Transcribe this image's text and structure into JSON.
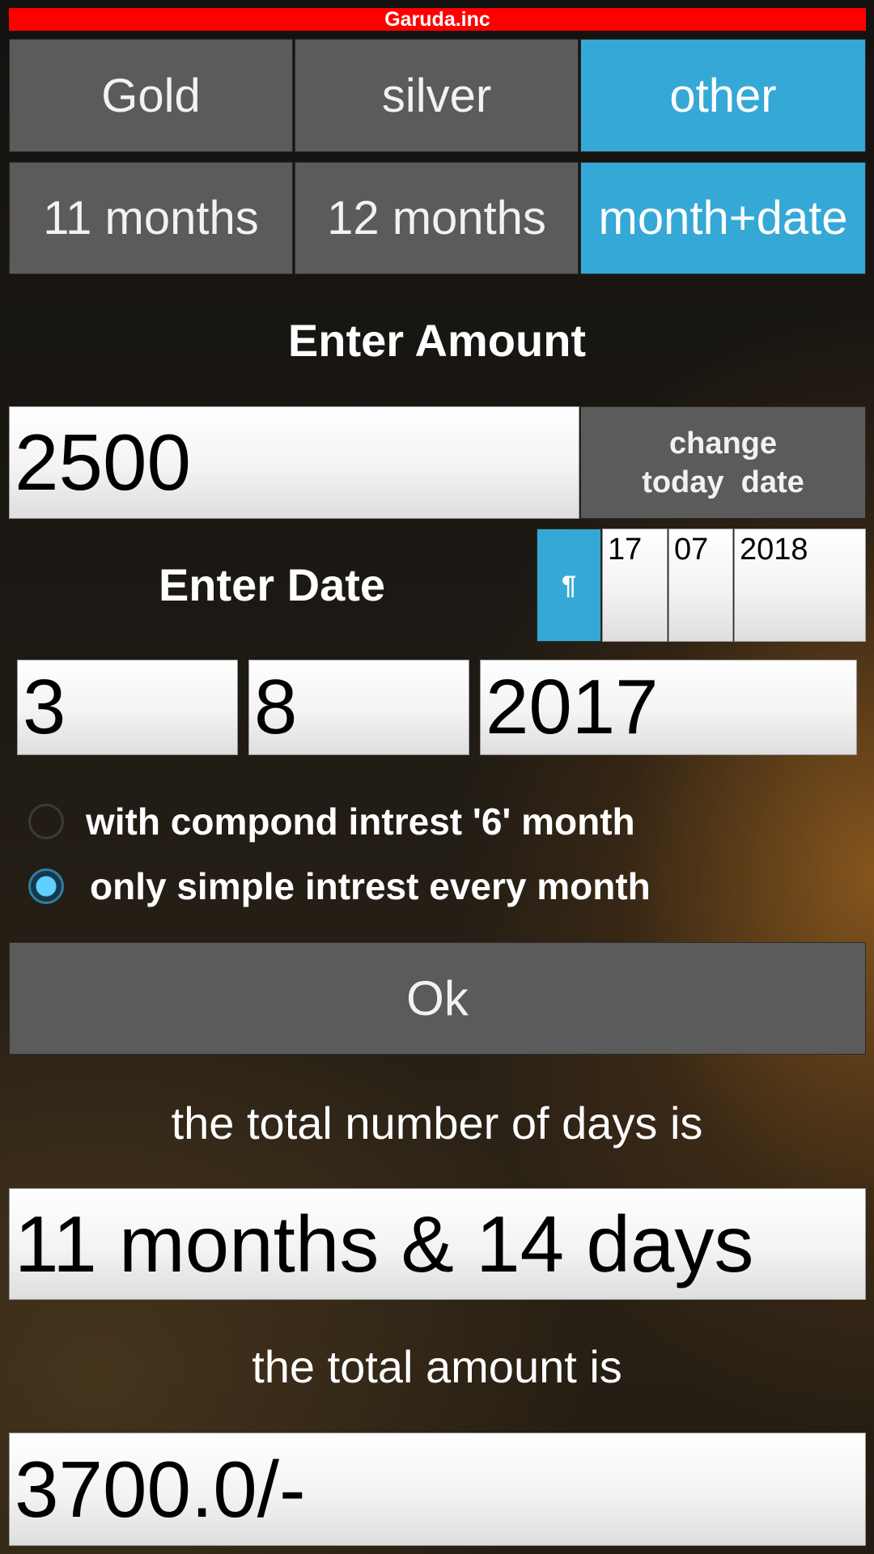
{
  "app": {
    "title": "Garuda.inc"
  },
  "metal_tabs": [
    {
      "label": "Gold",
      "active": false
    },
    {
      "label": "silver",
      "active": false
    },
    {
      "label": "other",
      "active": true
    }
  ],
  "period_tabs": [
    {
      "label": "11 months",
      "active": false
    },
    {
      "label": "12 months",
      "active": false
    },
    {
      "label": "month+date",
      "active": true
    }
  ],
  "amount": {
    "heading": "Enter Amount",
    "value": "2500",
    "change_date_line1": "change",
    "change_date_line2": "today  date"
  },
  "date": {
    "heading": "Enter Date",
    "today": {
      "icon": "¶",
      "day": "17",
      "month": "07",
      "year": "2018"
    },
    "day": "3",
    "month": "8",
    "year": "2017"
  },
  "interest": {
    "options": [
      {
        "label": "with compond  intrest '6' month",
        "selected": false
      },
      {
        "label": "only simple intrest every month",
        "selected": true
      }
    ]
  },
  "ok_label": "Ok",
  "result": {
    "days_label": "the total number of days is",
    "days_value": "11 months & 14 days",
    "amount_label": "the total amount is",
    "amount_value": "3700.0/-"
  },
  "colors": {
    "accent": "#35a8d6",
    "titlebar": "#ff0000",
    "button": "#5b5b5b"
  }
}
